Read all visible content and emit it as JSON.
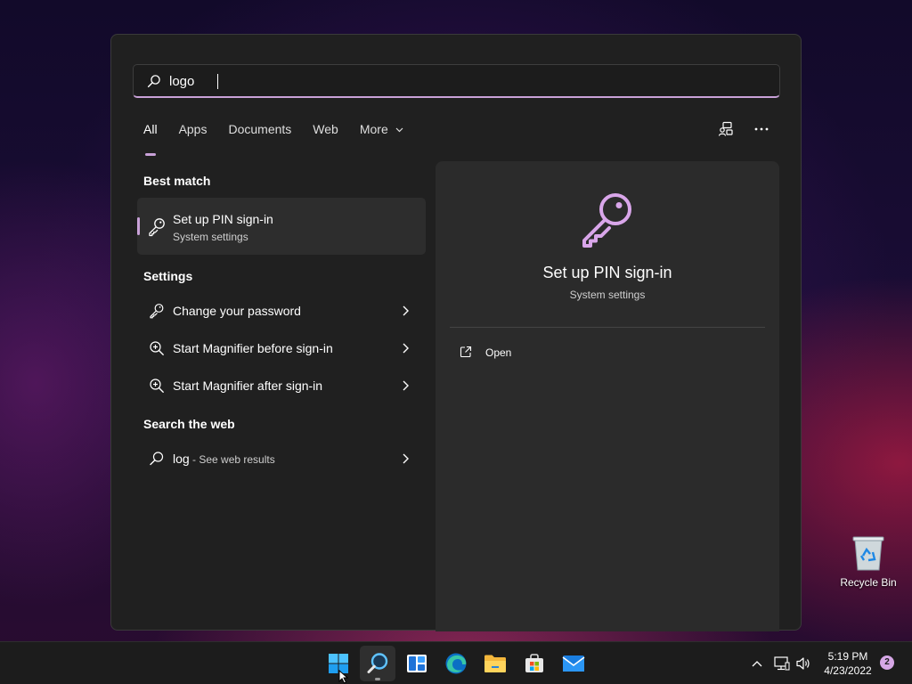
{
  "search": {
    "query": "logo"
  },
  "tabs": [
    {
      "label": "All"
    },
    {
      "label": "Apps"
    },
    {
      "label": "Documents"
    },
    {
      "label": "Web"
    },
    {
      "label": "More"
    }
  ],
  "sections": {
    "best_match": "Best match",
    "settings": "Settings",
    "search_web": "Search the web"
  },
  "best_match": {
    "title": "Set up PIN sign-in",
    "subtitle": "System settings"
  },
  "settings_items": [
    {
      "label": "Change your password",
      "icon": "key-icon"
    },
    {
      "label": "Start Magnifier before sign-in",
      "icon": "magnifier-icon"
    },
    {
      "label": "Start Magnifier after sign-in",
      "icon": "magnifier-icon"
    }
  ],
  "web_result": {
    "query": "log",
    "suffix": " - See web results"
  },
  "preview": {
    "title": "Set up PIN sign-in",
    "subtitle": "System settings",
    "open_label": "Open"
  },
  "desktop": {
    "recycle_bin": "Recycle Bin"
  },
  "taskbar": {
    "apps": [
      "start-button",
      "search-button",
      "widgets-button",
      "edge-button",
      "file-explorer-button",
      "store-button",
      "mail-button"
    ],
    "time": "5:19 PM",
    "date": "4/23/2022",
    "notification_count": "2"
  },
  "colors": {
    "accent": "#c9a1d8",
    "panel": "#202020",
    "preview": "#2b2b2b"
  }
}
